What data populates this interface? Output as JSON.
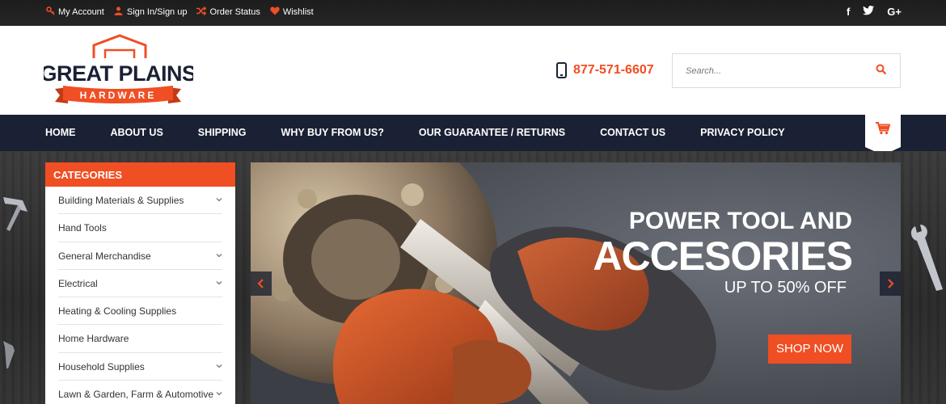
{
  "topbar": {
    "links": [
      {
        "label": "My Account",
        "icon": "key-icon"
      },
      {
        "label": "Sign In/Sign up",
        "icon": "user-icon"
      },
      {
        "label": "Order Status",
        "icon": "shuffle-icon"
      },
      {
        "label": "Wishlist",
        "icon": "heart-icon"
      }
    ],
    "social": [
      {
        "icon": "facebook-icon",
        "glyph": "f"
      },
      {
        "icon": "twitter-icon",
        "glyph": "t"
      },
      {
        "icon": "google-plus-icon",
        "glyph": "G+"
      }
    ]
  },
  "header": {
    "logo": {
      "line1": "GREAT PLAINS",
      "line2": "HARDWARE"
    },
    "phone": "877-571-6607",
    "search_placeholder": "Search..."
  },
  "nav": {
    "items": [
      "HOME",
      "ABOUT US",
      "SHIPPING",
      "WHY BUY FROM US?",
      "OUR GUARANTEE / RETURNS",
      "CONTACT US",
      "PRIVACY POLICY"
    ]
  },
  "categories": {
    "title": "CATEGORIES",
    "items": [
      {
        "label": "Building Materials & Supplies",
        "has_sub": true
      },
      {
        "label": "Hand Tools",
        "has_sub": false
      },
      {
        "label": "General Merchandise",
        "has_sub": true
      },
      {
        "label": "Electrical",
        "has_sub": true
      },
      {
        "label": "Heating & Cooling Supplies",
        "has_sub": false
      },
      {
        "label": "Home Hardware",
        "has_sub": false
      },
      {
        "label": "Household Supplies",
        "has_sub": true
      },
      {
        "label": "Lawn & Garden, Farm & Automotive",
        "has_sub": true
      }
    ]
  },
  "slider": {
    "line1": "POWER TOOL AND",
    "line2": "ACCESORIES",
    "line3": "UP TO 50% OFF",
    "button": "SHOP NOW"
  },
  "colors": {
    "accent": "#f04e23",
    "navy": "#1b2134",
    "topbar": "#222222"
  }
}
